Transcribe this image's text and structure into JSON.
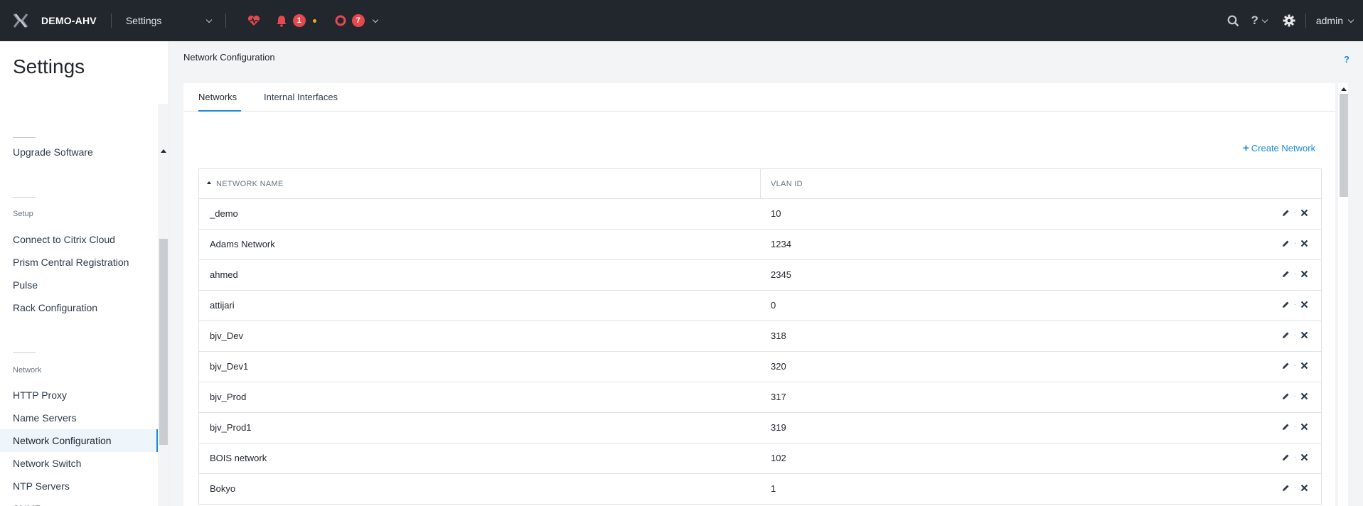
{
  "topbar": {
    "cluster_name": "DEMO-AHV",
    "menu_label": "Settings",
    "alert_count": "1",
    "event_count": "7",
    "user": "admin"
  },
  "sidebar": {
    "title": "Settings",
    "items_top": [
      {
        "label": "Upgrade Software"
      }
    ],
    "setup_label": "Setup",
    "setup_items": [
      {
        "label": "Connect to Citrix Cloud"
      },
      {
        "label": "Prism Central Registration"
      },
      {
        "label": "Pulse"
      },
      {
        "label": "Rack Configuration"
      }
    ],
    "network_label": "Network",
    "network_items": [
      {
        "label": "HTTP Proxy"
      },
      {
        "label": "Name Servers"
      },
      {
        "label": "Network Configuration"
      },
      {
        "label": "Network Switch"
      },
      {
        "label": "NTP Servers"
      },
      {
        "label": "SNMP"
      }
    ]
  },
  "main": {
    "breadcrumb": "Network Configuration",
    "help": "?",
    "tabs": [
      {
        "label": "Networks"
      },
      {
        "label": "Internal Interfaces"
      }
    ],
    "create_label": "Create Network",
    "columns": [
      "NETWORK NAME",
      "VLAN ID"
    ],
    "rows": [
      {
        "name": "_demo",
        "vlan": "10"
      },
      {
        "name": "Adams Network",
        "vlan": "1234"
      },
      {
        "name": "ahmed",
        "vlan": "2345"
      },
      {
        "name": "attijari",
        "vlan": "0"
      },
      {
        "name": "bjv_Dev",
        "vlan": "318"
      },
      {
        "name": "bjv_Dev1",
        "vlan": "320"
      },
      {
        "name": "bjv_Prod",
        "vlan": "317"
      },
      {
        "name": "bjv_Prod1",
        "vlan": "319"
      },
      {
        "name": "BOIS network",
        "vlan": "102"
      },
      {
        "name": "Bokyo",
        "vlan": "1"
      }
    ]
  },
  "colors": {
    "topbar_bg": "#22272e",
    "accent": "#1b8bd8",
    "badge": "#e5484d",
    "warning_dot": "#f5a623"
  }
}
